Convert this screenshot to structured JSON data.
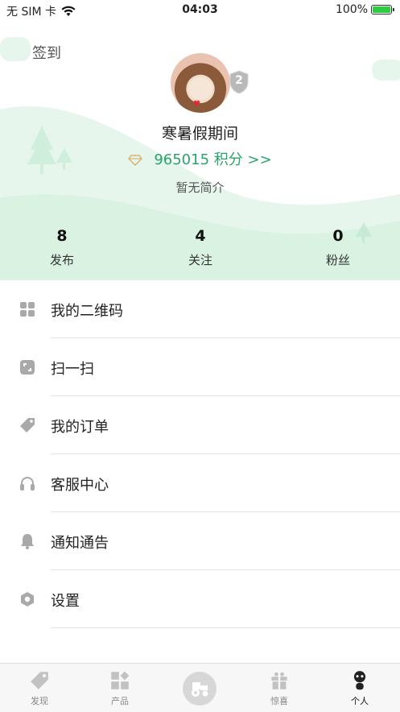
{
  "status_bar": {
    "carrier": "无 SIM 卡",
    "time": "04:03",
    "battery": "100%"
  },
  "header": {
    "signin_label": "签到"
  },
  "profile": {
    "nickname": "寒暑假期间",
    "level": "2",
    "points": "965015 积分 >>",
    "bio": "暂无简介"
  },
  "stats": [
    {
      "value": "8",
      "label": "发布"
    },
    {
      "value": "4",
      "label": "关注"
    },
    {
      "value": "0",
      "label": "粉丝"
    }
  ],
  "menu": [
    {
      "label": "我的二维码",
      "icon": "qr-code-icon"
    },
    {
      "label": "扫一扫",
      "icon": "scan-icon"
    },
    {
      "label": "我的订单",
      "icon": "tag-icon"
    },
    {
      "label": "客服中心",
      "icon": "headphones-icon"
    },
    {
      "label": "通知通告",
      "icon": "bell-icon"
    },
    {
      "label": "设置",
      "icon": "hexagon-settings-icon"
    }
  ],
  "tabs": [
    {
      "label": "发现",
      "icon": "tag-icon"
    },
    {
      "label": "产品",
      "icon": "grid-icon"
    },
    {
      "label": "惊喜",
      "icon": "gift-icon"
    },
    {
      "label": "个人",
      "icon": "person-icon",
      "active": true
    }
  ],
  "colors": {
    "accent_green": "#2aa36b",
    "hero_bg": "#e8f7ee",
    "icon_gray": "#a9a9a9"
  }
}
